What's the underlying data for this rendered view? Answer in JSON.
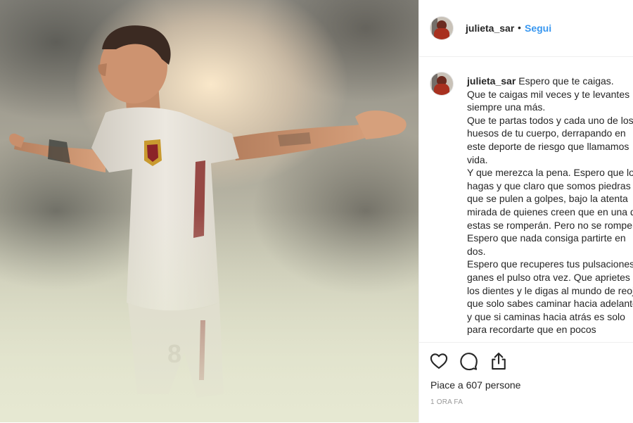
{
  "post": {
    "username": "julieta_sar",
    "separator": "•",
    "follow_label": "Segui",
    "caption_username": "julieta_sar",
    "caption_text": "Espero que te caigas.\nQue te caigas mil veces y te levantes siempre una más.\nQue te partas todos y cada uno de los huesos de tu cuerpo, derrapando en este deporte de riesgo que llamamos vida.\nY que merezca la pena. Espero que lo hagas y que claro que somos piedras que se pulen a golpes, bajo la atenta mirada de quienes creen que en una de estas se romperán. Pero no se rompen.\nEspero que nada consiga partirte en dos.\nEspero que recuperes tus pulsaciones y ganes el pulso otra vez. Que aprietes los dientes y le digas al mundo de reojo que solo sabes caminar hacia adelante y que si caminas hacia atrás es solo para recordarte que en pocos",
    "likes_text": "Piace a 607 persone",
    "timestamp": "1 ORA FA"
  },
  "icons": {
    "like": "heart-icon",
    "comment": "comment-icon",
    "share": "share-icon"
  },
  "colors": {
    "link": "#3897f0",
    "text": "#262626",
    "muted": "#999999",
    "border": "#efefef"
  }
}
